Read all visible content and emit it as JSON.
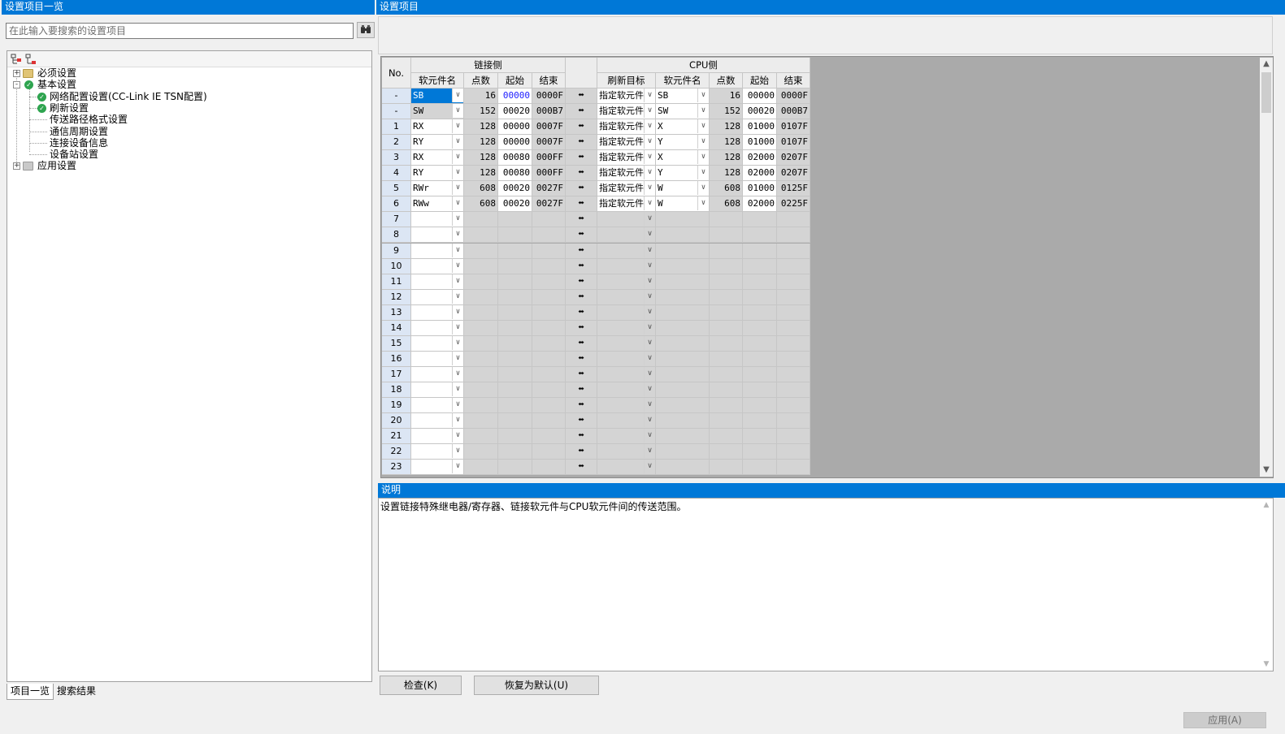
{
  "left_panel": {
    "title": "设置项目一览",
    "search_placeholder": "在此输入要搜索的设置项目",
    "search_icon": "binoculars-icon",
    "tree": [
      {
        "label": "必须设置",
        "level": 0,
        "expander": "+",
        "icon": "folder-icon"
      },
      {
        "label": "基本设置",
        "level": 0,
        "expander": "-",
        "icon": "check-icon"
      },
      {
        "label": "网络配置设置(CC-Link IE TSN配置)",
        "level": 1,
        "icon": "check-icon"
      },
      {
        "label": "刷新设置",
        "level": 1,
        "icon": "check-icon"
      },
      {
        "label": "传送路径格式设置",
        "level": 1
      },
      {
        "label": "通信周期设置",
        "level": 1
      },
      {
        "label": "连接设备信息",
        "level": 1
      },
      {
        "label": "设备站设置",
        "level": 1
      },
      {
        "label": "应用设置",
        "level": 0,
        "expander": "+",
        "icon": "folder-icon"
      }
    ],
    "tabs": [
      "项目一览",
      "搜索结果"
    ]
  },
  "right_panel": {
    "title": "设置项目",
    "grid": {
      "col_no": "No.",
      "group_link": "链接侧",
      "group_cpu": "CPU侧",
      "link_headers": [
        "软元件名",
        "点数",
        "起始",
        "结束"
      ],
      "refresh_header": "刷新目标",
      "cpu_headers": [
        "软元件名",
        "点数",
        "起始",
        "结束"
      ],
      "rows": [
        {
          "no": "-",
          "link_dev": "SB",
          "link_pts": "16",
          "link_start": "00000",
          "link_end": "0000F",
          "target": "指定软元件",
          "cpu_dev": "SB",
          "cpu_pts": "16",
          "cpu_start": "00000",
          "cpu_end": "0000F"
        },
        {
          "no": "-",
          "link_dev": "SW",
          "link_pts": "152",
          "link_start": "00020",
          "link_end": "000B7",
          "target": "指定软元件",
          "cpu_dev": "SW",
          "cpu_pts": "152",
          "cpu_start": "00020",
          "cpu_end": "000B7"
        },
        {
          "no": "1",
          "link_dev": "RX",
          "link_pts": "128",
          "link_start": "00000",
          "link_end": "0007F",
          "target": "指定软元件",
          "cpu_dev": "X",
          "cpu_pts": "128",
          "cpu_start": "01000",
          "cpu_end": "0107F"
        },
        {
          "no": "2",
          "link_dev": "RY",
          "link_pts": "128",
          "link_start": "00000",
          "link_end": "0007F",
          "target": "指定软元件",
          "cpu_dev": "Y",
          "cpu_pts": "128",
          "cpu_start": "01000",
          "cpu_end": "0107F"
        },
        {
          "no": "3",
          "link_dev": "RX",
          "link_pts": "128",
          "link_start": "00080",
          "link_end": "000FF",
          "target": "指定软元件",
          "cpu_dev": "X",
          "cpu_pts": "128",
          "cpu_start": "02000",
          "cpu_end": "0207F"
        },
        {
          "no": "4",
          "link_dev": "RY",
          "link_pts": "128",
          "link_start": "00080",
          "link_end": "000FF",
          "target": "指定软元件",
          "cpu_dev": "Y",
          "cpu_pts": "128",
          "cpu_start": "02000",
          "cpu_end": "0207F"
        },
        {
          "no": "5",
          "link_dev": "RWr",
          "link_pts": "608",
          "link_start": "00020",
          "link_end": "0027F",
          "target": "指定软元件",
          "cpu_dev": "W",
          "cpu_pts": "608",
          "cpu_start": "01000",
          "cpu_end": "0125F"
        },
        {
          "no": "6",
          "link_dev": "RWw",
          "link_pts": "608",
          "link_start": "00020",
          "link_end": "0027F",
          "target": "指定软元件",
          "cpu_dev": "W",
          "cpu_pts": "608",
          "cpu_start": "02000",
          "cpu_end": "0225F"
        },
        {
          "no": "7"
        },
        {
          "no": "8"
        },
        {
          "no": "9"
        },
        {
          "no": "10"
        },
        {
          "no": "11"
        },
        {
          "no": "12"
        },
        {
          "no": "13"
        },
        {
          "no": "14"
        },
        {
          "no": "15"
        },
        {
          "no": "16"
        },
        {
          "no": "17"
        },
        {
          "no": "18"
        },
        {
          "no": "19"
        },
        {
          "no": "20"
        },
        {
          "no": "21"
        },
        {
          "no": "22"
        },
        {
          "no": "23"
        }
      ]
    },
    "description": {
      "title": "说明",
      "text": "设置链接特殊继电器/寄存器、链接软元件与CPU软元件间的传送范围。"
    },
    "buttons": {
      "check": "检查(K)",
      "restore_default": "恢复为默认(U)"
    }
  },
  "footer": {
    "apply": "应用(A)"
  },
  "colors": {
    "title_bar": "#0078d7",
    "selected_cell": "#0078d7",
    "grid_background": "#aaaaaa",
    "disabled_cell": "#d4d4d4"
  }
}
